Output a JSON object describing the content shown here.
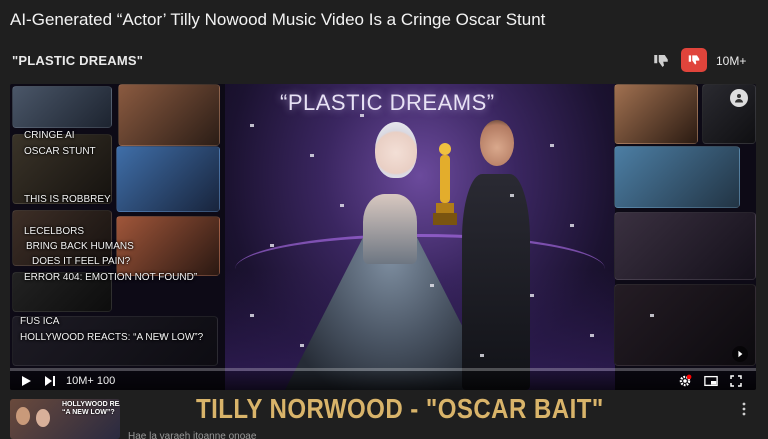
{
  "headline": "AI-Generated “Actor’ Tilly Nowood Music Video Is a Cringe Oscar Stunt",
  "subtitle": "\"PLASTIC DREAMS\"",
  "reactions": {
    "dislike_count": "10M+",
    "active_color": "#e0443b"
  },
  "video": {
    "title": "“PLASTIC DREAMS”",
    "overlay_lines": [
      "CRINGE AI",
      "OSCAR STUNT",
      "THIS IS ROBBREY",
      "LECELBORS",
      "BRING BACK HUMANS",
      "DOES IT FEEL PAIN?",
      "ERROR 404: EMOTION NOT FOUND”",
      "FUS ICA",
      "HOLLYWOOD REACTS:  “A NEW LOW”?"
    ],
    "progress_fraction": 0.0,
    "time_text": "10M+ 100",
    "settings_badge_color": "#ff0000"
  },
  "recommendation": {
    "thumb_text": "HOLLYWOOD REACTS:\n“A NEW LOW”?",
    "big_title": "TILLY NORWOOD - \"OSCAR BAIT\"",
    "caption": "Hae la varaeh itoanne onoae"
  },
  "icons": [
    "thumb-down-icon",
    "play-icon",
    "next-icon",
    "settings-icon",
    "miniplayer-icon",
    "fullscreen-icon",
    "more-vert-icon",
    "account-icon",
    "expand-icon"
  ]
}
